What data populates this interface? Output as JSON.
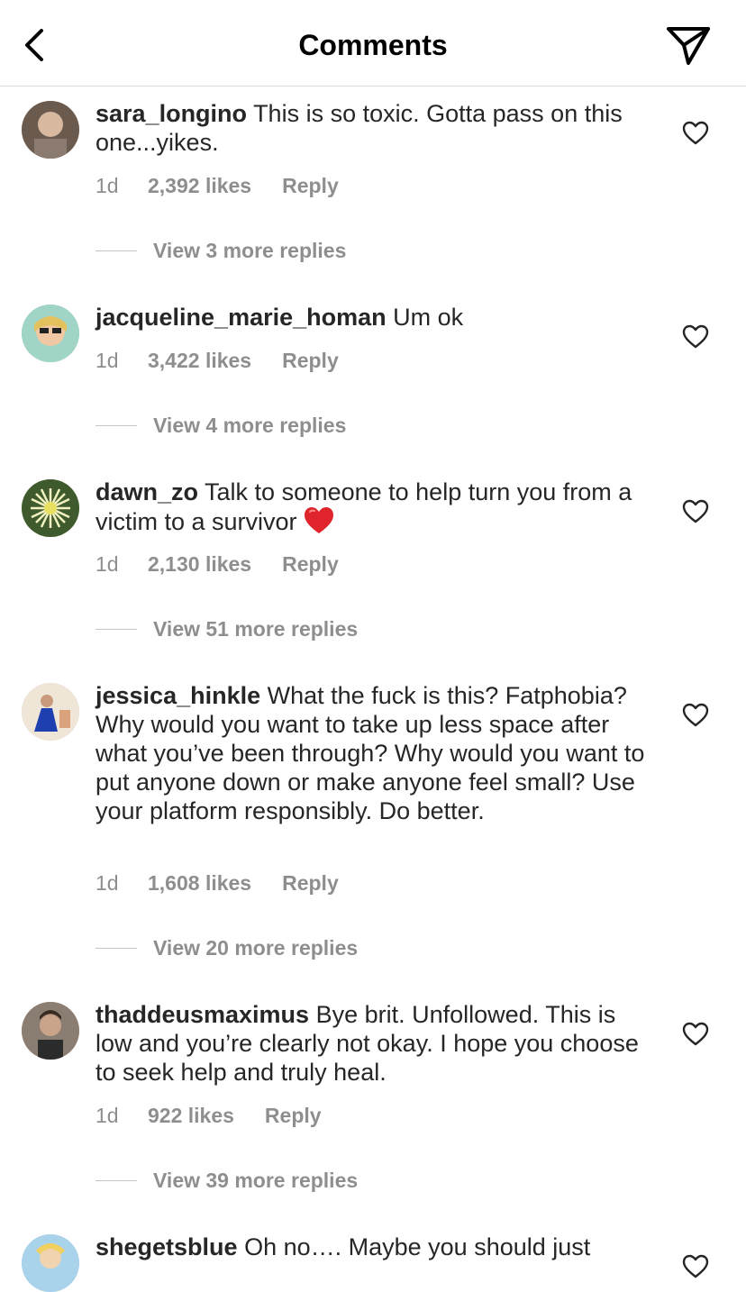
{
  "header": {
    "title": "Comments",
    "back_icon": "chevron-left-icon",
    "send_icon": "paper-plane-icon"
  },
  "comments": [
    {
      "username": "sara_longino",
      "text": "This is so toxic. Gotta pass on this one...yikes.",
      "time": "1d",
      "likes": "2,392 likes",
      "reply": "Reply",
      "view_replies": "View 3 more replies"
    },
    {
      "username": "jacqueline_marie_homan",
      "text": "Um ok",
      "time": "1d",
      "likes": "3,422 likes",
      "reply": "Reply",
      "view_replies": "View 4 more replies"
    },
    {
      "username": "dawn_zo",
      "text": "Talk to someone to help turn you from a victim to a survivor",
      "emoji": "red-heart-emoji",
      "time": "1d",
      "likes": "2,130 likes",
      "reply": "Reply",
      "view_replies": "View 51 more replies"
    },
    {
      "username": "jessica_hinkle",
      "text": "What the fuck is this? Fatphobia? Why would you want to take up less space after what you’ve been through? Why would you want to put anyone down or make anyone feel small? Use your platform responsibly. Do better.",
      "time": "1d",
      "likes": "1,608 likes",
      "reply": "Reply",
      "view_replies": "View 20 more replies"
    },
    {
      "username": "thaddeusmaximus",
      "text": "Bye brit. Unfollowed. This is low and you’re clearly not okay. I hope you choose to seek help and truly heal.",
      "time": "1d",
      "likes": "922 likes",
      "reply": "Reply",
      "view_replies": "View 39 more replies"
    },
    {
      "username": "shegetsblue",
      "text": "Oh no…. Maybe you should just"
    }
  ],
  "colors": {
    "text": "#262626",
    "secondary": "#8e8e8e",
    "divider": "#dbdbdb",
    "emoji_heart": "#e0242b"
  }
}
